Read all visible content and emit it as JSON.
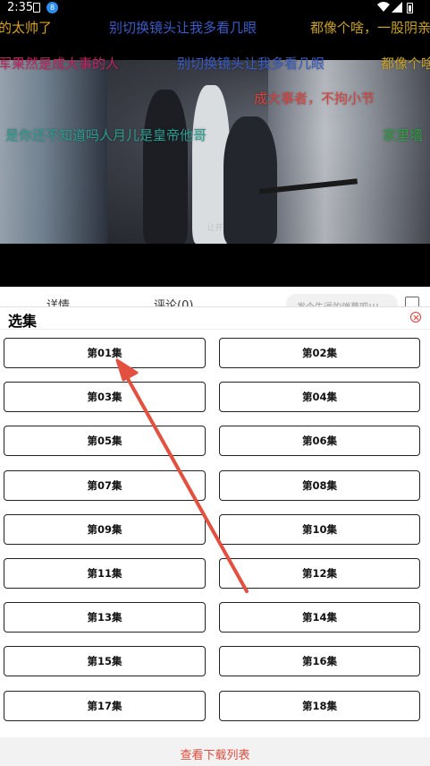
{
  "status_bar": {
    "time": "2:35",
    "notification_badge": "8",
    "icons": [
      "sim-icon",
      "app-badge-icon",
      "wifi-icon",
      "signal-icon",
      "battery-icon"
    ]
  },
  "video": {
    "subtitle": "让开",
    "danmaku": [
      {
        "text": "的太帅了",
        "color": "#d6a21e"
      },
      {
        "text": "别切换镜头让我多看几眼",
        "color": "#3b5cc4"
      },
      {
        "text": "都像个啥，一股阴亲",
        "color": "#c9a227"
      },
      {
        "text": "军果然是成大事的人",
        "color": "#c3245e"
      },
      {
        "text": "别切换镜头让我多看几眼",
        "color": "#3b5cc4"
      },
      {
        "text": "都像个啥",
        "color": "#c9a227"
      },
      {
        "text": "成大事者，不拘小节",
        "color": "#e0403a"
      },
      {
        "text": "是你还不知道吗人月儿是皇帝他哥",
        "color": "#2a9d8f"
      },
      {
        "text": "家里墙",
        "color": "#2ea043"
      }
    ]
  },
  "tabs": {
    "detail": "详情",
    "comment": "评论(0)",
    "danmaku_placeholder": "发个牛逼的弹幕吧!!!"
  },
  "panel": {
    "title": "选集",
    "episodes": [
      "第01集",
      "第02集",
      "第03集",
      "第04集",
      "第05集",
      "第06集",
      "第07集",
      "第08集",
      "第09集",
      "第10集",
      "第11集",
      "第12集",
      "第13集",
      "第14集",
      "第15集",
      "第16集",
      "第17集",
      "第18集"
    ],
    "download_link": "查看下载列表"
  },
  "colors": {
    "accent_red": "#e24a3b",
    "annotation_arrow": "#e2503f"
  }
}
